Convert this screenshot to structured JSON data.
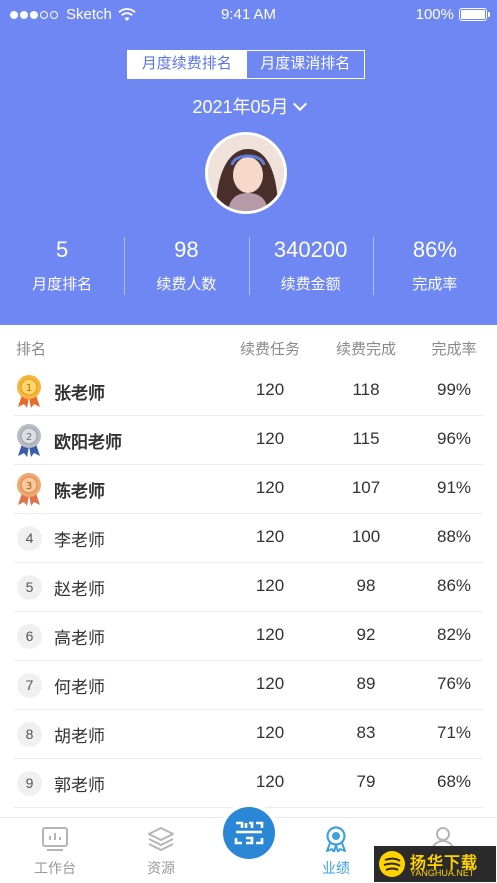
{
  "status_bar": {
    "carrier": "Sketch",
    "time": "9:41 AM",
    "battery": "100%"
  },
  "header": {
    "tabs": [
      {
        "label": "月度续费排名",
        "active": true
      },
      {
        "label": "月度课消排名",
        "active": false
      }
    ],
    "month": "2021年05月",
    "stats": [
      {
        "value": "5",
        "label": "月度排名"
      },
      {
        "value": "98",
        "label": "续费人数"
      },
      {
        "value": "340200",
        "label": "续费金额"
      },
      {
        "value": "86%",
        "label": "完成率"
      }
    ],
    "accent_color": "#6f87f2"
  },
  "table": {
    "headers": {
      "rank": "排名",
      "task": "续费任务",
      "done": "续费完成",
      "rate": "完成率"
    },
    "rows": [
      {
        "rank": "1",
        "name": "张老师",
        "task": "120",
        "done": "118",
        "rate": "99%",
        "medal": "gold"
      },
      {
        "rank": "2",
        "name": "欧阳老师",
        "task": "120",
        "done": "115",
        "rate": "96%",
        "medal": "silver"
      },
      {
        "rank": "3",
        "name": "陈老师",
        "task": "120",
        "done": "107",
        "rate": "91%",
        "medal": "bronze"
      },
      {
        "rank": "4",
        "name": "李老师",
        "task": "120",
        "done": "100",
        "rate": "88%"
      },
      {
        "rank": "5",
        "name": "赵老师",
        "task": "120",
        "done": "98",
        "rate": "86%"
      },
      {
        "rank": "6",
        "name": "高老师",
        "task": "120",
        "done": "92",
        "rate": "82%"
      },
      {
        "rank": "7",
        "name": "何老师",
        "task": "120",
        "done": "89",
        "rate": "76%"
      },
      {
        "rank": "8",
        "name": "胡老师",
        "task": "120",
        "done": "83",
        "rate": "71%"
      },
      {
        "rank": "9",
        "name": "郭老师",
        "task": "120",
        "done": "79",
        "rate": "68%"
      }
    ]
  },
  "tabbar": {
    "items": [
      {
        "label": "工作台",
        "icon": "chart-icon"
      },
      {
        "label": "资源",
        "icon": "layers-icon"
      },
      {
        "label": "业绩",
        "icon": "award-icon",
        "active": true
      },
      {
        "label": "",
        "icon": "person-icon"
      }
    ],
    "center_icon": "scan-code-icon",
    "active_color": "#3ea0e0"
  },
  "watermark": {
    "title": "扬华下载",
    "subtitle": "YANGHUA.NET"
  }
}
